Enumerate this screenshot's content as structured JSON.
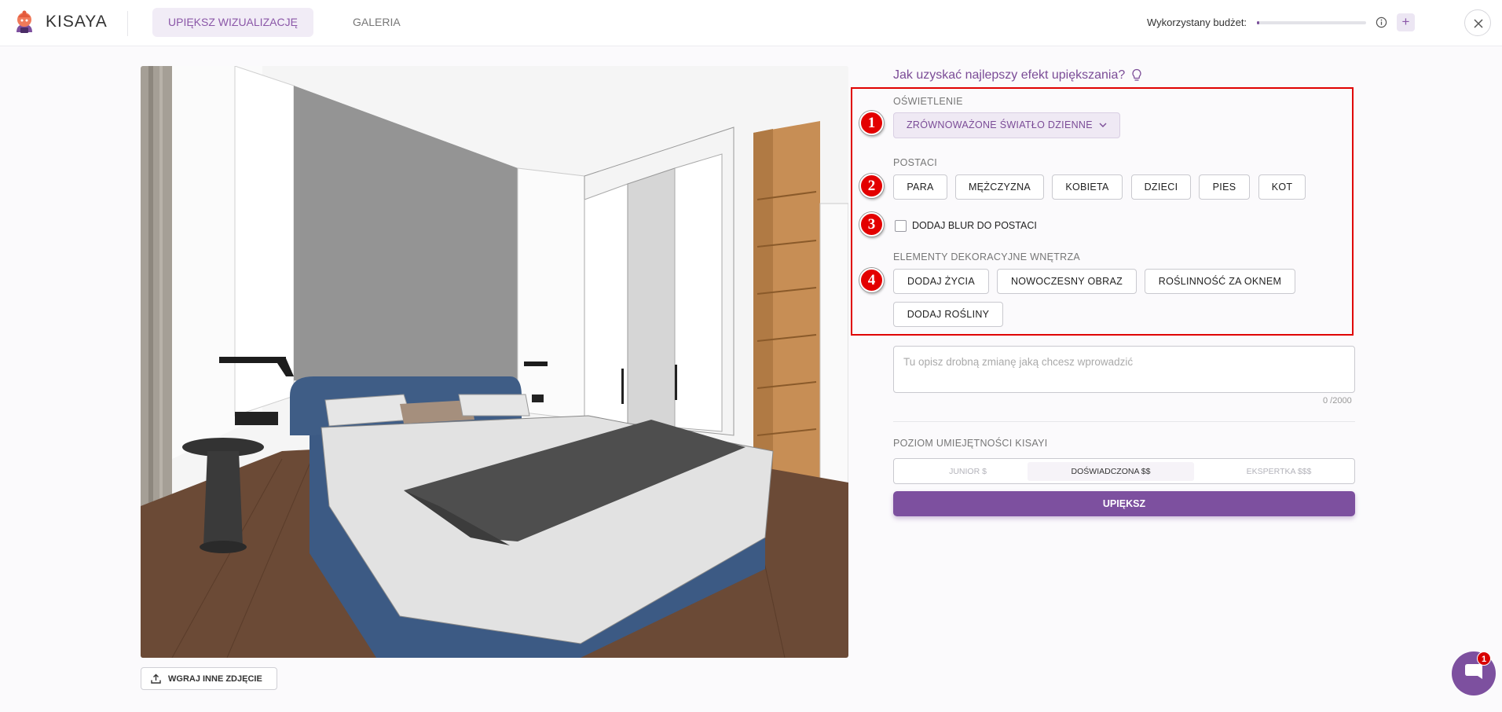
{
  "app": {
    "name": "KISAYA",
    "tabs": [
      {
        "label": "UPIĘKSZ WIZUALIZACJĘ",
        "active": true
      },
      {
        "label": "GALERIA",
        "active": false
      }
    ],
    "budget": {
      "label": "Wykorzystany budżet:",
      "used_fraction": 0.02
    },
    "add_label": "+",
    "accent_color": "#7d509f"
  },
  "image": {
    "upload_label": "WGRAJ INNE ZDJĘCIE",
    "upload_icon": "upload-icon"
  },
  "panel": {
    "tip": "Jak uzyskać najlepszy efekt upiększania?",
    "markers": [
      "1",
      "2",
      "3",
      "4"
    ],
    "lighting": {
      "label": "OŚWIETLENIE",
      "selected": "ZRÓWNOWAŻONE ŚWIATŁO DZIENNE"
    },
    "characters": {
      "label": "POSTACI",
      "options": [
        "PARA",
        "MĘŻCZYZNA",
        "KOBIETA",
        "DZIECI",
        "PIES",
        "KOT"
      ]
    },
    "blur": {
      "label": "DODAJ BLUR DO POSTACI",
      "checked": false
    },
    "decor": {
      "label": "ELEMENTY DEKORACYJNE WNĘTRZA",
      "options": [
        "DODAJ ŻYCIA",
        "NOWOCZESNY OBRAZ",
        "ROŚLINNOŚĆ ZA OKNEM",
        "DODAJ ROŚLINY"
      ]
    },
    "prompt": {
      "placeholder": "Tu opisz drobną zmianę jaką chcesz wprowadzić",
      "counter": "0 /2000"
    },
    "skill": {
      "label": "POZIOM UMIEJĘTNOŚCI KISAYI",
      "options": [
        "JUNIOR $",
        "DOŚWIADCZONA $$",
        "EKSPERTKA $$$"
      ],
      "selected": "DOŚWIADCZONA $$"
    },
    "submit_label": "UPIĘKSZ"
  },
  "chat": {
    "badge": "1"
  }
}
